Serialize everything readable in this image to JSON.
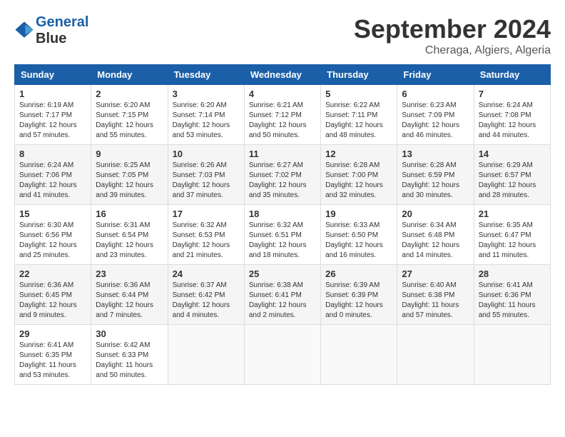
{
  "logo": {
    "line1": "General",
    "line2": "Blue"
  },
  "header": {
    "month": "September 2024",
    "location": "Cheraga, Algiers, Algeria"
  },
  "days_of_week": [
    "Sunday",
    "Monday",
    "Tuesday",
    "Wednesday",
    "Thursday",
    "Friday",
    "Saturday"
  ],
  "weeks": [
    [
      {
        "day": "1",
        "info": "Sunrise: 6:19 AM\nSunset: 7:17 PM\nDaylight: 12 hours\nand 57 minutes."
      },
      {
        "day": "2",
        "info": "Sunrise: 6:20 AM\nSunset: 7:15 PM\nDaylight: 12 hours\nand 55 minutes."
      },
      {
        "day": "3",
        "info": "Sunrise: 6:20 AM\nSunset: 7:14 PM\nDaylight: 12 hours\nand 53 minutes."
      },
      {
        "day": "4",
        "info": "Sunrise: 6:21 AM\nSunset: 7:12 PM\nDaylight: 12 hours\nand 50 minutes."
      },
      {
        "day": "5",
        "info": "Sunrise: 6:22 AM\nSunset: 7:11 PM\nDaylight: 12 hours\nand 48 minutes."
      },
      {
        "day": "6",
        "info": "Sunrise: 6:23 AM\nSunset: 7:09 PM\nDaylight: 12 hours\nand 46 minutes."
      },
      {
        "day": "7",
        "info": "Sunrise: 6:24 AM\nSunset: 7:08 PM\nDaylight: 12 hours\nand 44 minutes."
      }
    ],
    [
      {
        "day": "8",
        "info": "Sunrise: 6:24 AM\nSunset: 7:06 PM\nDaylight: 12 hours\nand 41 minutes."
      },
      {
        "day": "9",
        "info": "Sunrise: 6:25 AM\nSunset: 7:05 PM\nDaylight: 12 hours\nand 39 minutes."
      },
      {
        "day": "10",
        "info": "Sunrise: 6:26 AM\nSunset: 7:03 PM\nDaylight: 12 hours\nand 37 minutes."
      },
      {
        "day": "11",
        "info": "Sunrise: 6:27 AM\nSunset: 7:02 PM\nDaylight: 12 hours\nand 35 minutes."
      },
      {
        "day": "12",
        "info": "Sunrise: 6:28 AM\nSunset: 7:00 PM\nDaylight: 12 hours\nand 32 minutes."
      },
      {
        "day": "13",
        "info": "Sunrise: 6:28 AM\nSunset: 6:59 PM\nDaylight: 12 hours\nand 30 minutes."
      },
      {
        "day": "14",
        "info": "Sunrise: 6:29 AM\nSunset: 6:57 PM\nDaylight: 12 hours\nand 28 minutes."
      }
    ],
    [
      {
        "day": "15",
        "info": "Sunrise: 6:30 AM\nSunset: 6:56 PM\nDaylight: 12 hours\nand 25 minutes."
      },
      {
        "day": "16",
        "info": "Sunrise: 6:31 AM\nSunset: 6:54 PM\nDaylight: 12 hours\nand 23 minutes."
      },
      {
        "day": "17",
        "info": "Sunrise: 6:32 AM\nSunset: 6:53 PM\nDaylight: 12 hours\nand 21 minutes."
      },
      {
        "day": "18",
        "info": "Sunrise: 6:32 AM\nSunset: 6:51 PM\nDaylight: 12 hours\nand 18 minutes."
      },
      {
        "day": "19",
        "info": "Sunrise: 6:33 AM\nSunset: 6:50 PM\nDaylight: 12 hours\nand 16 minutes."
      },
      {
        "day": "20",
        "info": "Sunrise: 6:34 AM\nSunset: 6:48 PM\nDaylight: 12 hours\nand 14 minutes."
      },
      {
        "day": "21",
        "info": "Sunrise: 6:35 AM\nSunset: 6:47 PM\nDaylight: 12 hours\nand 11 minutes."
      }
    ],
    [
      {
        "day": "22",
        "info": "Sunrise: 6:36 AM\nSunset: 6:45 PM\nDaylight: 12 hours\nand 9 minutes."
      },
      {
        "day": "23",
        "info": "Sunrise: 6:36 AM\nSunset: 6:44 PM\nDaylight: 12 hours\nand 7 minutes."
      },
      {
        "day": "24",
        "info": "Sunrise: 6:37 AM\nSunset: 6:42 PM\nDaylight: 12 hours\nand 4 minutes."
      },
      {
        "day": "25",
        "info": "Sunrise: 6:38 AM\nSunset: 6:41 PM\nDaylight: 12 hours\nand 2 minutes."
      },
      {
        "day": "26",
        "info": "Sunrise: 6:39 AM\nSunset: 6:39 PM\nDaylight: 12 hours\nand 0 minutes."
      },
      {
        "day": "27",
        "info": "Sunrise: 6:40 AM\nSunset: 6:38 PM\nDaylight: 11 hours\nand 57 minutes."
      },
      {
        "day": "28",
        "info": "Sunrise: 6:41 AM\nSunset: 6:36 PM\nDaylight: 11 hours\nand 55 minutes."
      }
    ],
    [
      {
        "day": "29",
        "info": "Sunrise: 6:41 AM\nSunset: 6:35 PM\nDaylight: 11 hours\nand 53 minutes."
      },
      {
        "day": "30",
        "info": "Sunrise: 6:42 AM\nSunset: 6:33 PM\nDaylight: 11 hours\nand 50 minutes."
      },
      {
        "day": "",
        "info": ""
      },
      {
        "day": "",
        "info": ""
      },
      {
        "day": "",
        "info": ""
      },
      {
        "day": "",
        "info": ""
      },
      {
        "day": "",
        "info": ""
      }
    ]
  ]
}
